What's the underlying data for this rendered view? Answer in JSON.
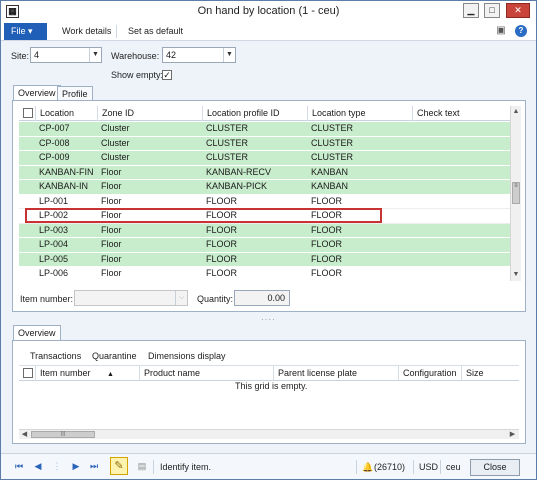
{
  "window": {
    "title": "On hand by location (1 - ceu)",
    "app_icon": "form-icon",
    "controls": [
      "minimize-icon",
      "maximize-icon",
      "close-icon"
    ]
  },
  "menubar": {
    "file_label": "File",
    "file_caret": "▾",
    "items": [
      "Work details",
      "Set as default"
    ],
    "right_icons": [
      "panel-icon",
      "help-icon"
    ]
  },
  "filters": {
    "site_label": "Site:",
    "site_value": "4",
    "warehouse_label": "Warehouse:",
    "warehouse_value": "42",
    "show_empty_label": "Show empty:",
    "show_empty_checked": true
  },
  "tabs": {
    "overview": "Overview",
    "profile": "Profile"
  },
  "grid": {
    "columns": [
      "Location",
      "Zone ID",
      "Location profile ID",
      "Location type",
      "Check text"
    ],
    "rows": [
      {
        "location": "CP-007",
        "zone": "Cluster",
        "profile": "CLUSTER",
        "type": "CLUSTER",
        "style": "green"
      },
      {
        "location": "CP-008",
        "zone": "Cluster",
        "profile": "CLUSTER",
        "type": "CLUSTER",
        "style": "green"
      },
      {
        "location": "CP-009",
        "zone": "Cluster",
        "profile": "CLUSTER",
        "type": "CLUSTER",
        "style": "green"
      },
      {
        "location": "KANBAN-FIN",
        "zone": "Floor",
        "profile": "KANBAN-RECV",
        "type": "KANBAN",
        "style": "green"
      },
      {
        "location": "KANBAN-IN",
        "zone": "Floor",
        "profile": "KANBAN-PICK",
        "type": "KANBAN",
        "style": "green"
      },
      {
        "location": "LP-001",
        "zone": "Floor",
        "profile": "FLOOR",
        "type": "FLOOR",
        "style": "white"
      },
      {
        "location": "LP-002",
        "zone": "Floor",
        "profile": "FLOOR",
        "type": "FLOOR",
        "style": "selected"
      },
      {
        "location": "LP-003",
        "zone": "Floor",
        "profile": "FLOOR",
        "type": "FLOOR",
        "style": "green"
      },
      {
        "location": "LP-004",
        "zone": "Floor",
        "profile": "FLOOR",
        "type": "FLOOR",
        "style": "green"
      },
      {
        "location": "LP-005",
        "zone": "Floor",
        "profile": "FLOOR",
        "type": "FLOOR",
        "style": "green"
      },
      {
        "location": "LP-006",
        "zone": "Floor",
        "profile": "FLOOR",
        "type": "FLOOR",
        "style": "white"
      }
    ]
  },
  "item_bar": {
    "item_number_label": "Item number:",
    "item_number_value": "",
    "quantity_label": "Quantity:",
    "quantity_value": "0.00"
  },
  "bottom": {
    "tab": "Overview",
    "toolbar": [
      "Transactions",
      "Quarantine",
      "Dimensions display"
    ],
    "columns": [
      "Item number",
      "Product name",
      "Parent license plate",
      "Configuration",
      "Size"
    ],
    "sort_indicator": "▲",
    "empty_text": "This grid is empty."
  },
  "statusbar": {
    "message": "Identify item.",
    "notifications": "(26710)",
    "currency": "USD",
    "company": "ceu",
    "close_label": "Close"
  },
  "colors": {
    "row_green": "#c8edcc",
    "selection_outline": "#c83232",
    "file_button": "#1f5fb8"
  }
}
